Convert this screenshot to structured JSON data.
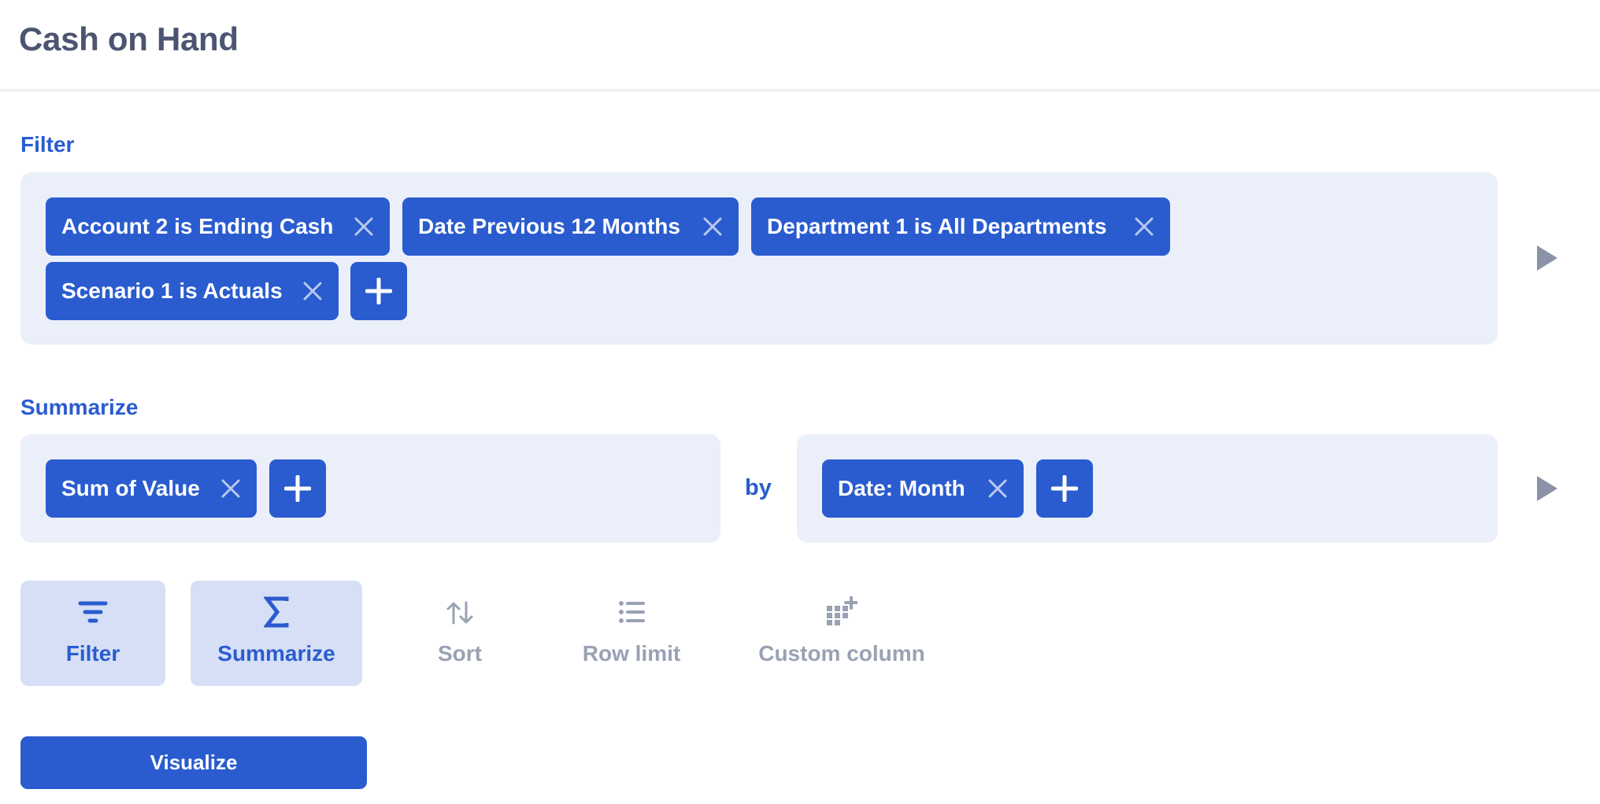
{
  "page": {
    "title": "Cash on Hand"
  },
  "filter": {
    "label": "Filter",
    "chips": [
      {
        "label": "Account 2 is Ending Cash"
      },
      {
        "label": "Date Previous 12 Months"
      },
      {
        "label": "Department 1 is All Departments"
      },
      {
        "label": "Scenario 1 is Actuals"
      }
    ]
  },
  "summarize": {
    "label": "Summarize",
    "metrics": [
      {
        "label": "Sum of Value"
      }
    ],
    "by_label": "by",
    "groupings": [
      {
        "label": "Date: Month"
      }
    ]
  },
  "actions": [
    {
      "label": "Filter",
      "icon": "filter-icon",
      "active": true
    },
    {
      "label": "Summarize",
      "icon": "sigma-icon",
      "active": true
    },
    {
      "label": "Sort",
      "icon": "sort-icon",
      "active": false
    },
    {
      "label": "Row limit",
      "icon": "list-icon",
      "active": false
    },
    {
      "label": "Custom column",
      "icon": "grid-plus-icon",
      "active": false
    }
  ],
  "visualize_button": {
    "label": "Visualize"
  },
  "colors": {
    "accent": "#2a5ccf",
    "panel": "#ebeff9",
    "active_action": "#d6dff5",
    "muted": "#99a1b3"
  }
}
